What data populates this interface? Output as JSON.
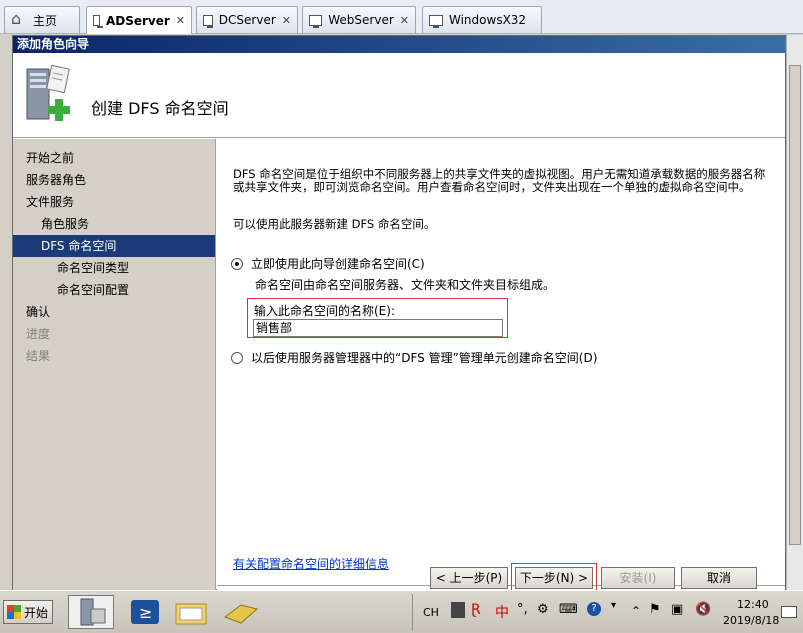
{
  "tabs": [
    {
      "label": "主页",
      "icon": "home-icon",
      "active": false,
      "closable": false
    },
    {
      "label": "ADServer",
      "icon": "vm-icon",
      "active": true,
      "closable": true
    },
    {
      "label": "DCServer",
      "icon": "vm-icon",
      "active": false,
      "closable": true
    },
    {
      "label": "WebServer",
      "icon": "vm-icon",
      "active": false,
      "closable": true
    },
    {
      "label": "WindowsX32",
      "icon": "vm-icon",
      "active": false,
      "closable": true
    }
  ],
  "wizard": {
    "window_title": "添加角色向导",
    "banner_title": "创建 DFS 命名空间",
    "nav": [
      {
        "label": "开始之前",
        "level": 0,
        "state": "normal"
      },
      {
        "label": "服务器角色",
        "level": 0,
        "state": "normal"
      },
      {
        "label": "文件服务",
        "level": 0,
        "state": "normal"
      },
      {
        "label": "角色服务",
        "level": 1,
        "state": "normal"
      },
      {
        "label": "DFS 命名空间",
        "level": 1,
        "state": "active"
      },
      {
        "label": "命名空间类型",
        "level": 2,
        "state": "normal"
      },
      {
        "label": "命名空间配置",
        "level": 2,
        "state": "normal"
      },
      {
        "label": "确认",
        "level": 0,
        "state": "normal"
      },
      {
        "label": "进度",
        "level": 0,
        "state": "disabled"
      },
      {
        "label": "结果",
        "level": 0,
        "state": "disabled"
      }
    ],
    "description": "DFS 命名空间是位于组织中不同服务器上的共享文件夹的虚拟视图。用户无需知道承载数据的服务器名称或共享文件夹，即可浏览命名空间。用户查看命名空间时，文件夹出现在一个单独的虚拟命名空间中。",
    "can_create_text": "可以使用此服务器新建 DFS 命名空间。",
    "option_now": {
      "label": "立即使用此向导创建命名空间(C)",
      "checked": true,
      "note": "命名空间由命名空间服务器、文件夹和文件夹目标组成。"
    },
    "name_label": "输入此命名空间的名称(E):",
    "name_value": "销售部",
    "option_later": {
      "label": "以后使用服务器管理器中的“DFS 管理”管理单元创建命名空间(D)",
      "checked": false
    },
    "help_link": "有关配置命名空间的详细信息",
    "buttons": {
      "back": "< 上一步(P)",
      "next": "下一步(N) >",
      "install": "安装(I)",
      "cancel": "取消"
    }
  },
  "taskbar": {
    "start_label": "开始",
    "apps": [
      "server-manager-icon",
      "powershell-icon",
      "explorer-icon",
      "tools-icon"
    ],
    "tray": {
      "lang": "CH",
      "ime_char": "中",
      "time": "12:40",
      "date": "2019/8/18"
    }
  }
}
